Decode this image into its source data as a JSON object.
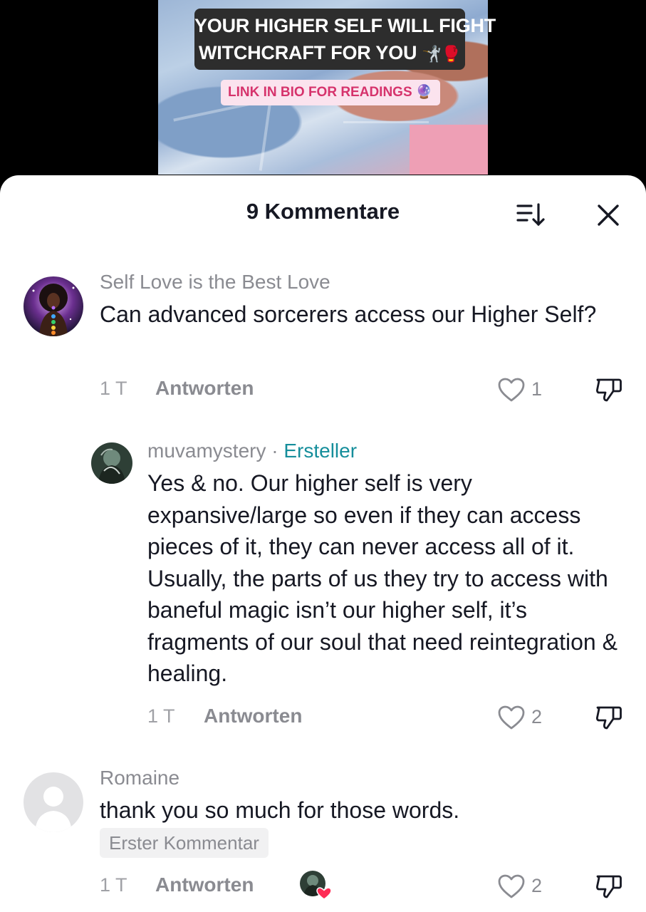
{
  "video": {
    "caption_line1": "YOUR HIGHER SELF WILL FIGHT",
    "caption_line2": "WITCHCRAFT FOR YOU",
    "caption_emoji": "🤺🥊",
    "link_label": "LINK IN BIO FOR READINGS",
    "link_emoji": "🔮"
  },
  "sheet": {
    "title": "9 Kommentare",
    "sort_icon": "sort-icon",
    "close_icon": "close-icon"
  },
  "comments": [
    {
      "author": "Self Love is the Best Love",
      "text": "Can advanced sorcerers access our Higher Self?",
      "age": "1 T",
      "reply_label": "Antworten",
      "likes": "1"
    },
    {
      "author": "muvamystery",
      "separator": " · ",
      "creator_label": "Ersteller",
      "text": "Yes & no. Our higher self is very expansive/large so even if they can access pieces of it, they can never access all of it. Usually, the parts of us they try to access with baneful magic isn’t our higher self, it’s fragments of our soul that need reintegration & healing.",
      "age": "1 T",
      "reply_label": "Antworten",
      "likes": "2"
    },
    {
      "author": "Romaine",
      "text": "thank you so much for those words.",
      "badge": "Erster Kommentar",
      "age": "1 T",
      "reply_label": "Antworten",
      "likes": "2"
    }
  ],
  "colors": {
    "creator_accent": "#158e9b",
    "badge_bg": "#f1f1f2",
    "liked_heart": "#fe2c55"
  }
}
